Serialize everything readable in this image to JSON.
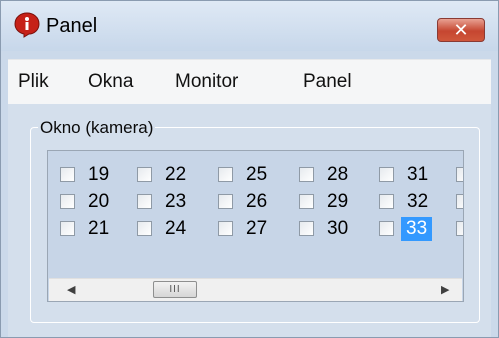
{
  "window": {
    "title": "Panel",
    "close_symbol": "✕",
    "title_icon": "info-shield-icon"
  },
  "menu": {
    "items": [
      "Plik",
      "Okna",
      "Monitor",
      "Panel"
    ]
  },
  "group": {
    "label": "Okno (kamera)"
  },
  "cameras": {
    "rows": [
      [
        "19",
        "22",
        "25",
        "28",
        "31"
      ],
      [
        "20",
        "23",
        "26",
        "29",
        "32"
      ],
      [
        "21",
        "24",
        "27",
        "30",
        "33"
      ]
    ],
    "selected": "33"
  },
  "scrollbar": {
    "left_arrow": "◀",
    "right_arrow": "▶",
    "grip": "III"
  },
  "colors": {
    "selection": "#3399ff",
    "close_button": "#c54630"
  }
}
